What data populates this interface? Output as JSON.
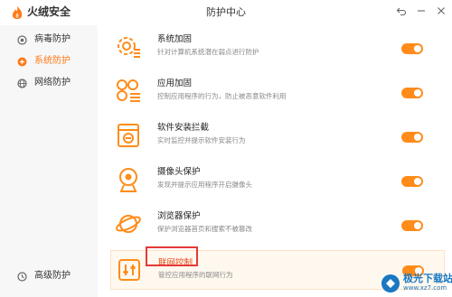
{
  "app": {
    "name": "火绒安全",
    "window_title": "防护中心",
    "accent": "#ff8c1a"
  },
  "window_controls": [
    "undo-icon",
    "minimize-icon",
    "close-icon"
  ],
  "sidebar": {
    "items": [
      {
        "label": "病毒防护",
        "icon": "virus-shield-icon",
        "active": false
      },
      {
        "label": "系统防护",
        "icon": "system-shield-icon",
        "active": true
      },
      {
        "label": "网络防护",
        "icon": "network-shield-icon",
        "active": false
      },
      {
        "label": "高级防护",
        "icon": "advanced-shield-icon",
        "active": false
      }
    ]
  },
  "features": [
    {
      "title": "系统加固",
      "desc": "针对计算机系统潜在弱点进行防护",
      "icon": "system-harden-icon",
      "enabled": true
    },
    {
      "title": "应用加固",
      "desc": "控制应用程序的行为，防止被恶意软件利用",
      "icon": "app-harden-icon",
      "enabled": true
    },
    {
      "title": "软件安装拦截",
      "desc": "实时监控并提示软件安装行为",
      "icon": "install-block-icon",
      "enabled": true
    },
    {
      "title": "摄像头保护",
      "desc": "发现并提示应用程序开启摄像头",
      "icon": "camera-icon",
      "enabled": true
    },
    {
      "title": "浏览器保护",
      "desc": "保护浏览器首页和搜索不被篡改",
      "icon": "browser-icon",
      "enabled": true
    },
    {
      "title": "联网控制",
      "desc": "管控应用程序的联网行为",
      "icon": "network-control-icon",
      "enabled": true
    }
  ],
  "watermark": {
    "text": "极光下载站",
    "url": "www.xz7.com"
  }
}
